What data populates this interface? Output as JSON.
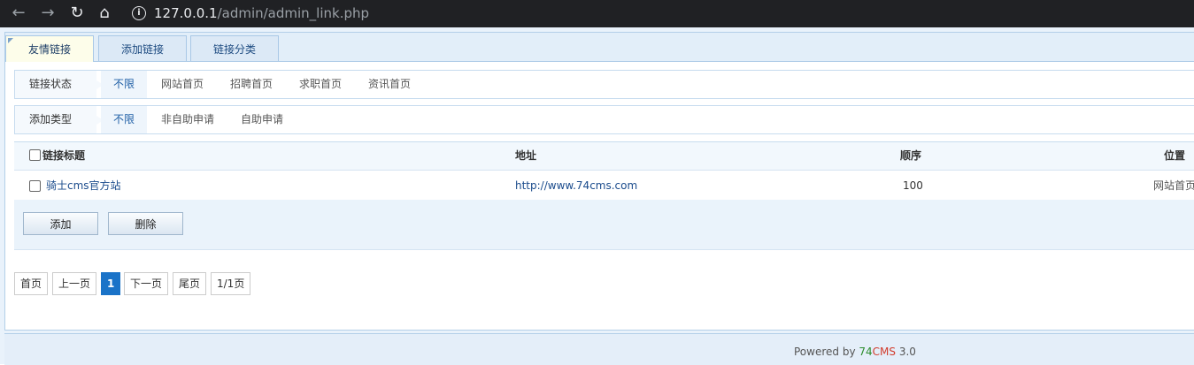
{
  "browser": {
    "url_host": "127.0.0.1",
    "url_path": "/admin/admin_link.php"
  },
  "tabs": [
    {
      "label": "友情链接",
      "active": true
    },
    {
      "label": "添加链接",
      "active": false
    },
    {
      "label": "链接分类",
      "active": false
    }
  ],
  "filter_status": {
    "label": "链接状态",
    "options": [
      "不限",
      "网站首页",
      "招聘首页",
      "求职首页",
      "资讯首页"
    ],
    "selected": "不限"
  },
  "filter_type": {
    "label": "添加类型",
    "options": [
      "不限",
      "非自助申请",
      "自助申请"
    ],
    "selected": "不限"
  },
  "table": {
    "headers": {
      "title": "链接标题",
      "url": "地址",
      "order": "顺序",
      "position": "位置"
    },
    "rows": [
      {
        "title": "骑士cms官方站",
        "url": "http://www.74cms.com",
        "order": "100",
        "position": "网站首页"
      }
    ]
  },
  "actions": {
    "add": "添加",
    "delete": "删除"
  },
  "pager": {
    "first": "首页",
    "prev": "上一页",
    "current": "1",
    "next": "下一页",
    "last": "尾页",
    "info": "1/1页"
  },
  "footer": {
    "prefix": "Powered by ",
    "brand_a": "74",
    "brand_b": "CMS",
    "version": " 3.0"
  },
  "colors": {
    "accent": "#1a73c8",
    "brand_green": "#2c8c2c",
    "brand_red": "#d23b2b"
  }
}
